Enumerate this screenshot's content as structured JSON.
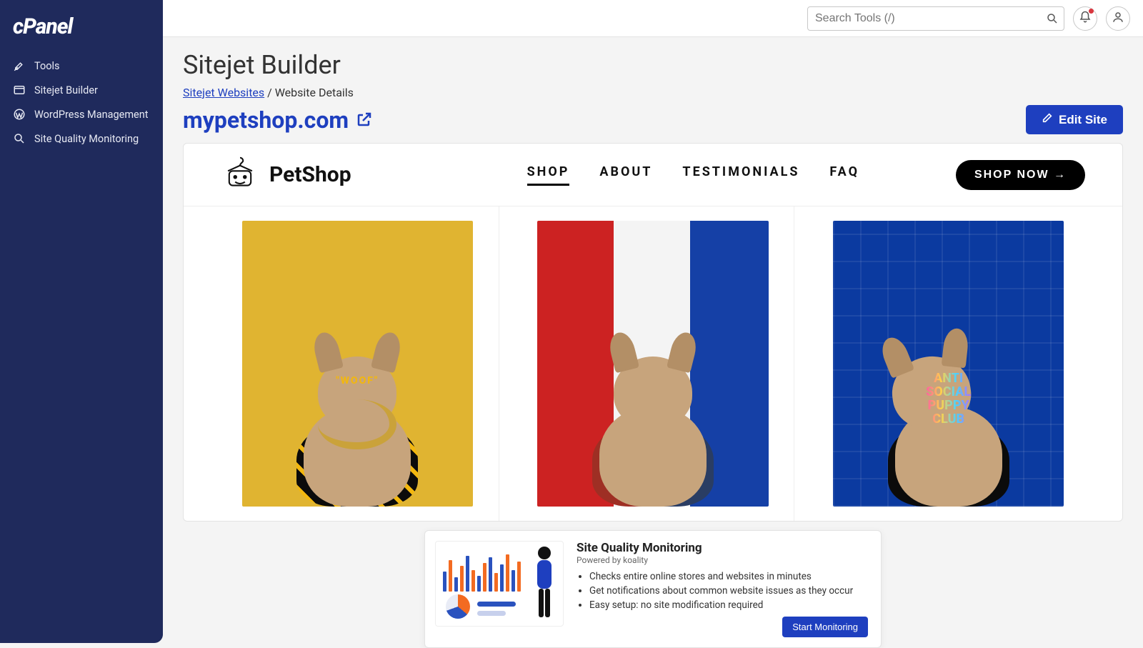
{
  "brand": "cPanel",
  "sidebar": {
    "items": [
      {
        "label": "Tools",
        "icon": "tools-icon"
      },
      {
        "label": "Sitejet Builder",
        "icon": "sitejet-icon"
      },
      {
        "label": "WordPress Management",
        "icon": "wordpress-icon"
      },
      {
        "label": "Site Quality Monitoring",
        "icon": "magnifier-icon"
      }
    ]
  },
  "topbar": {
    "search_placeholder": "Search Tools (/)"
  },
  "page": {
    "title": "Sitejet Builder",
    "breadcrumb_link": "Sitejet Websites",
    "breadcrumb_sep": " / ",
    "breadcrumb_current": "Website Details",
    "domain": "mypetshop.com",
    "edit_button": "Edit Site"
  },
  "preview": {
    "logo_text": "PetShop",
    "nav": [
      {
        "label": "SHOP",
        "active": true
      },
      {
        "label": "ABOUT",
        "active": false
      },
      {
        "label": "TESTIMONIALS",
        "active": false
      },
      {
        "label": "FAQ",
        "active": false
      }
    ],
    "cta": "SHOP NOW →",
    "products": [
      {
        "overlay": "\"WOOF\"",
        "bg": "#e0b431",
        "hoodie": "#0b0b0b",
        "accent": "#f2b70f"
      },
      {
        "overlay": "",
        "bg": "linear-gradient(90deg,#c22 0 33%,#fff 33% 66%,#1540a6 66% 100%)",
        "hoodie": "linear-gradient(90deg,#c73a2a 0 50%, #23355e 50% 100%)",
        "accent": ""
      },
      {
        "overlay": "ANTI\nSOCIAL\nPUPPY\nCLUB",
        "bg": "linear-gradient(#0b3aa0,#0b3aa0),repeating-linear-gradient(0deg,#0b3aa0 0 36px,#0f4ac4 36px 40px),repeating-linear-gradient(90deg,#0b3aa0 0 36px,#0f4ac4 36px 40px)",
        "hoodie": "#0b0b0b",
        "accent": ""
      }
    ]
  },
  "promo": {
    "title": "Site Quality Monitoring",
    "subtitle": "Powered by koality",
    "bullets": [
      "Checks entire online stores and websites in minutes",
      "Get notifications about common website issues as they occur",
      "Easy setup: no site modification required"
    ],
    "button": "Start Monitoring"
  },
  "colors": {
    "sidebar_bg": "#1f2a5c",
    "primary": "#1e3fbf"
  }
}
